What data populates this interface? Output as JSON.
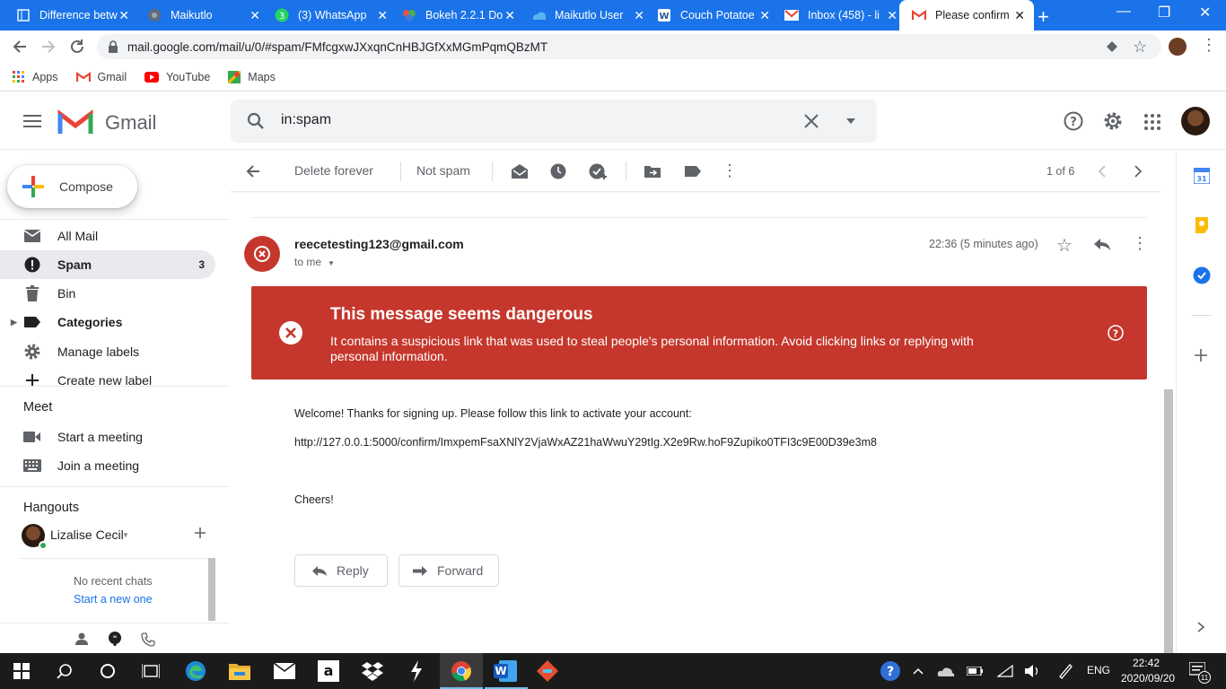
{
  "browser": {
    "tabs": [
      {
        "title": "Difference betw"
      },
      {
        "title": "Maikutlo"
      },
      {
        "title": "(3) WhatsApp"
      },
      {
        "title": "Bokeh 2.2.1 Do"
      },
      {
        "title": "Maikutlo User"
      },
      {
        "title": "Couch Potatoe"
      },
      {
        "title": "Inbox (458) - li"
      },
      {
        "title": "Please confirm"
      }
    ],
    "url": "mail.google.com/mail/u/0/#spam/FMfcgxwJXxqnCnHBJGfXxMGmPqmQBzMT",
    "bookmarks": [
      "Apps",
      "Gmail",
      "YouTube",
      "Maps"
    ]
  },
  "gmail": {
    "logo_text": "Gmail",
    "search_value": "in:spam",
    "compose_label": "Compose",
    "nav": [
      {
        "label": "All Mail"
      },
      {
        "label": "Spam",
        "count": "3"
      },
      {
        "label": "Bin"
      },
      {
        "label": "Categories"
      },
      {
        "label": "Manage labels"
      },
      {
        "label": "Create new label"
      }
    ],
    "meet": {
      "title": "Meet",
      "start": "Start a meeting",
      "join": "Join a meeting"
    },
    "hangouts": {
      "title": "Hangouts",
      "user": "Lizalise Cecil",
      "no_chats": "No recent chats",
      "start_new": "Start a new one"
    },
    "toolbar": {
      "delete_forever": "Delete forever",
      "not_spam": "Not spam",
      "pagination": "1 of 6"
    },
    "message": {
      "sender": "reecetesting123@gmail.com",
      "to": "to me",
      "time": "22:36 (5 minutes ago)",
      "warning_title": "This message seems dangerous",
      "warning_body": "It contains a suspicious link that was used to steal people's personal information. Avoid clicking links or replying with personal information.",
      "body_line1": "Welcome! Thanks for signing up. Please follow this link to activate your account:",
      "link": "http://127.0.0.1:5000/confirm/ImxpemFsaXNlY2VjaWxAZ21haWwuY29tIg.X2e9Rw.hoF9Zupiko0TFI3c9E00D39e3m8",
      "closing": "Cheers!",
      "reply": "Reply",
      "forward": "Forward"
    }
  },
  "taskbar": {
    "lang": "ENG",
    "time": "22:42",
    "date": "2020/09/20",
    "notif_count": "11"
  },
  "colors": {
    "chrome_blue": "#1a73e8",
    "danger_red": "#c5372c",
    "gmail_red": "#ea4335"
  }
}
